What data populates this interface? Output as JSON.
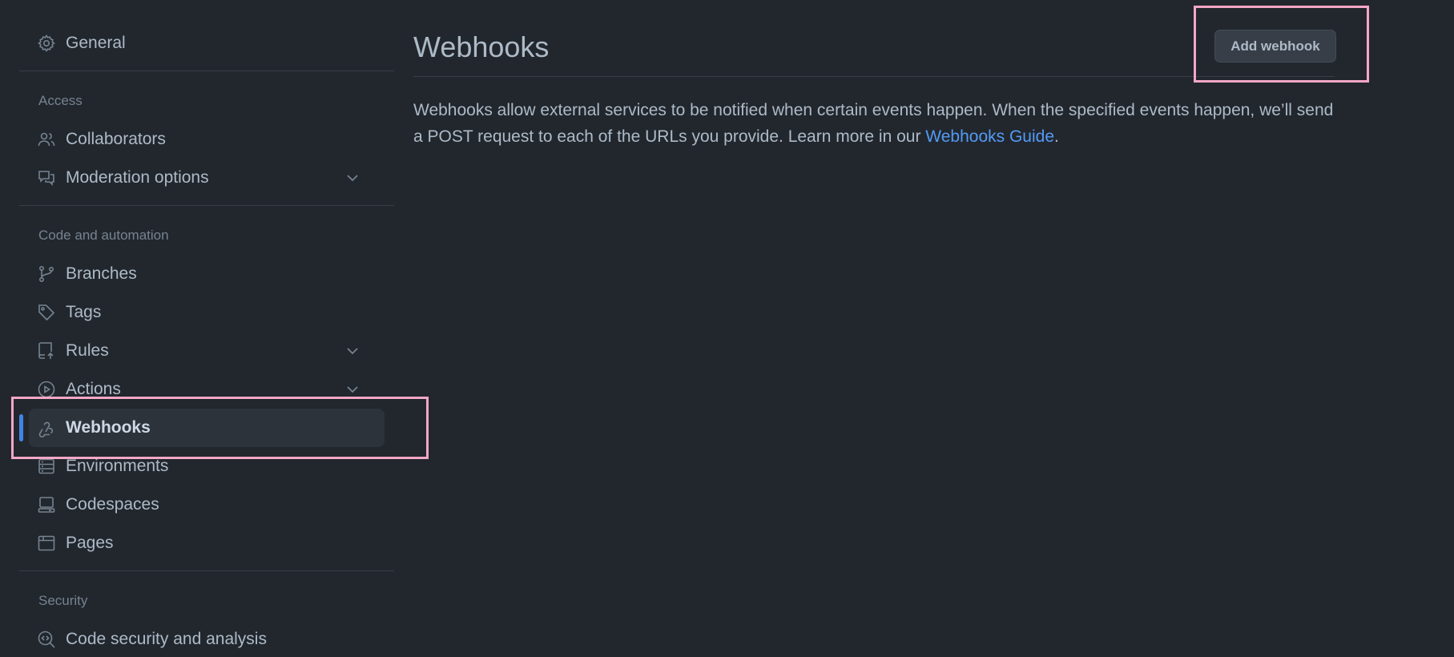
{
  "sidebar": {
    "general": "General",
    "access_heading": "Access",
    "collaborators": "Collaborators",
    "moderation": "Moderation options",
    "code_heading": "Code and automation",
    "branches": "Branches",
    "tags": "Tags",
    "rules": "Rules",
    "actions": "Actions",
    "webhooks": "Webhooks",
    "environments": "Environments",
    "codespaces": "Codespaces",
    "pages": "Pages",
    "security_heading": "Security",
    "code_security": "Code security and analysis"
  },
  "main": {
    "title": "Webhooks",
    "add_button": "Add webhook",
    "description_before": "Webhooks allow external services to be notified when certain events happen. When the specified events happen, we’ll send a POST request to each of the URLs you provide. Learn more in our ",
    "description_link": "Webhooks Guide",
    "description_after": "."
  },
  "colors": {
    "background": "#22272e",
    "accent": "#539bf5",
    "highlight": "#f4a7c6"
  }
}
